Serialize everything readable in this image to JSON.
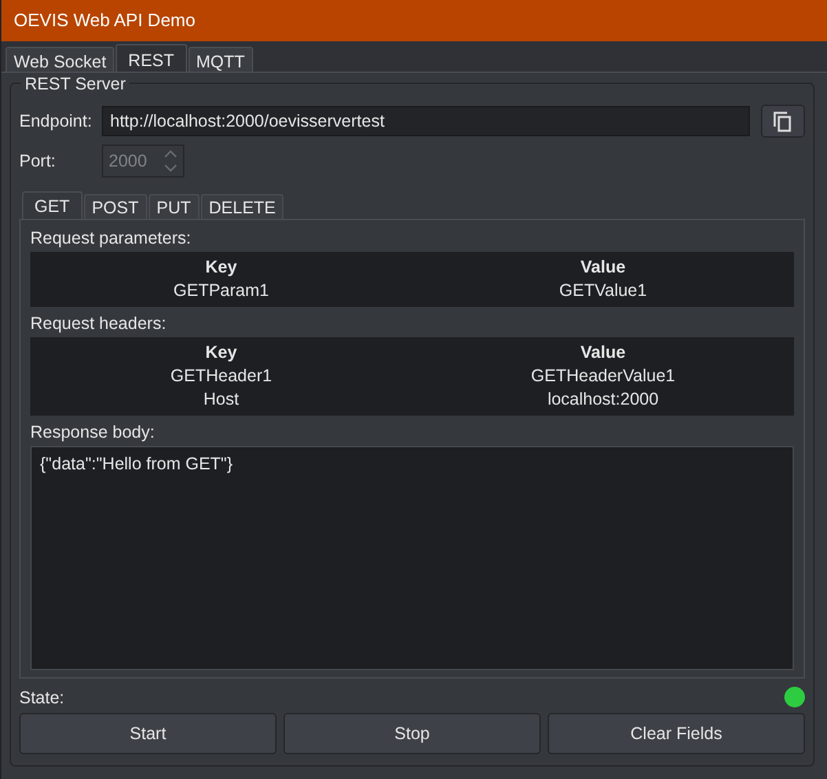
{
  "window": {
    "title": "OEVIS Web API Demo"
  },
  "tabs": [
    {
      "label": "Web Socket",
      "selected": false
    },
    {
      "label": "REST",
      "selected": true
    },
    {
      "label": "MQTT",
      "selected": false
    }
  ],
  "group": {
    "title": "REST Server"
  },
  "endpoint": {
    "label": "Endpoint:",
    "value": "http://localhost:2000/oevisservertest"
  },
  "port": {
    "label": "Port:",
    "value": "2000",
    "disabled": true
  },
  "method_tabs": [
    {
      "label": "GET",
      "selected": true
    },
    {
      "label": "POST",
      "selected": false
    },
    {
      "label": "PUT",
      "selected": false
    },
    {
      "label": "DELETE",
      "selected": false
    }
  ],
  "tables": [
    {
      "title": "Request parameters:",
      "columns": [
        "Key",
        "Value"
      ],
      "rows": [
        [
          "GETParam1",
          "GETValue1"
        ]
      ]
    },
    {
      "title": "Request headers:",
      "columns": [
        "Key",
        "Value"
      ],
      "rows": [
        [
          "GETHeader1",
          "GETHeaderValue1"
        ],
        [
          "Host",
          "localhost:2000"
        ]
      ]
    }
  ],
  "response": {
    "label": "Response body:",
    "value": "{\"data\":\"Hello from GET\"}"
  },
  "state": {
    "label": "State:",
    "active": true
  },
  "buttons": [
    "Start",
    "Stop",
    "Clear Fields"
  ]
}
